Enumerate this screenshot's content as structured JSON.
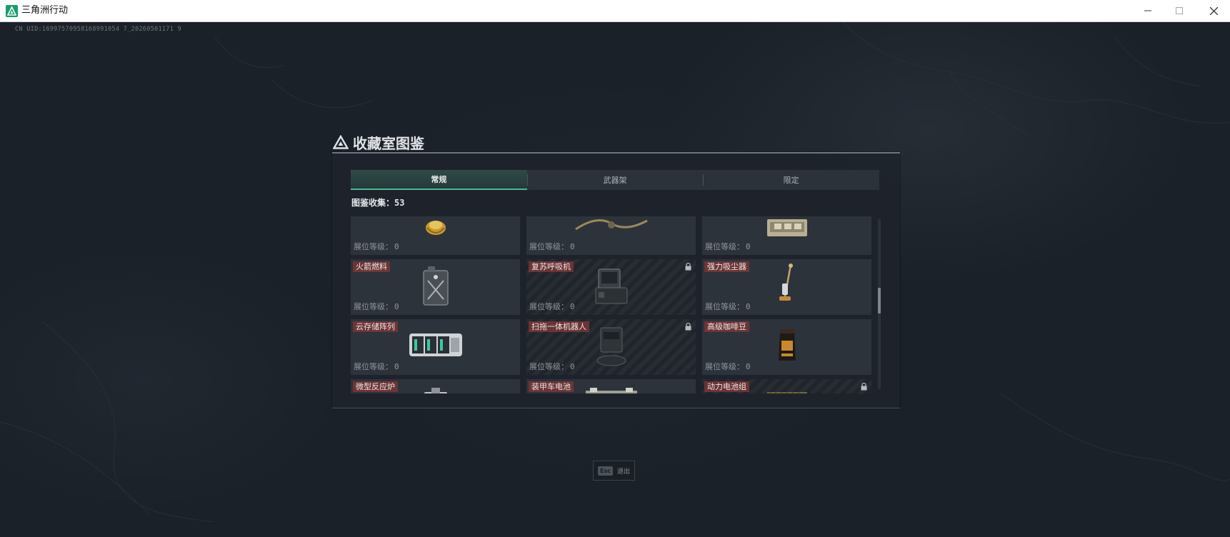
{
  "window": {
    "title": "三角洲行动",
    "minimize": "—",
    "maximize": "☐",
    "close": "✕"
  },
  "uid_text": "CN UID:16997570958168991054 7_20260501171 9",
  "panel": {
    "title": "收藏室图鉴",
    "tabs": [
      {
        "label": "常规",
        "active": true
      },
      {
        "label": "武器架",
        "active": false
      },
      {
        "label": "限定",
        "active": false
      }
    ],
    "collected_label": "图鉴收集：",
    "collected_value": "53",
    "level_label": "展位等级：",
    "items": [
      {
        "name": "",
        "level": "0",
        "locked": false,
        "icon": "gold-jewel-icon"
      },
      {
        "name": "",
        "level": "0",
        "locked": false,
        "icon": "antique-ornament-icon"
      },
      {
        "name": "",
        "level": "0",
        "locked": false,
        "icon": "open-case-icon"
      },
      {
        "name": "火箭燃料",
        "level": "0",
        "locked": false,
        "icon": "fuel-canister-icon"
      },
      {
        "name": "复苏呼吸机",
        "level": "0",
        "locked": true,
        "icon": "ventilator-icon"
      },
      {
        "name": "强力吸尘器",
        "level": "0",
        "locked": false,
        "icon": "vacuum-cleaner-icon"
      },
      {
        "name": "云存储阵列",
        "level": "0",
        "locked": false,
        "icon": "storage-array-icon"
      },
      {
        "name": "扫拖一体机器人",
        "level": "0",
        "locked": true,
        "icon": "mopping-robot-icon"
      },
      {
        "name": "高级咖啡豆",
        "level": "0",
        "locked": false,
        "icon": "coffee-bag-icon"
      },
      {
        "name": "微型反应炉",
        "level": "",
        "locked": false,
        "icon": "mini-reactor-icon"
      },
      {
        "name": "装甲车电池",
        "level": "",
        "locked": false,
        "icon": "vehicle-battery-icon"
      },
      {
        "name": "动力电池组",
        "level": "",
        "locked": true,
        "icon": "battery-pack-icon"
      }
    ]
  },
  "footer": {
    "esc_key": "Esc",
    "esc_label": "退出"
  }
}
